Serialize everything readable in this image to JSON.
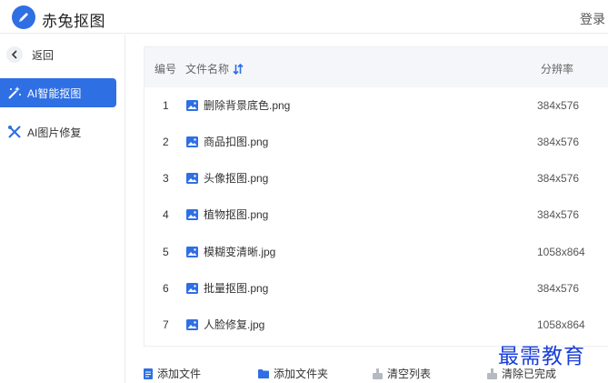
{
  "header": {
    "app_title": "赤兔抠图",
    "login_label": "登录",
    "logo_icon": "pen-logo-icon",
    "accent_color": "#2f6fe4"
  },
  "sidebar": {
    "back_label": "返回",
    "items": [
      {
        "label": "AI智能抠图",
        "icon": "magic-wand-icon",
        "active": true
      },
      {
        "label": "AI图片修复",
        "icon": "tools-icon",
        "active": false
      }
    ]
  },
  "table": {
    "columns": {
      "number": "编号",
      "filename": "文件名称",
      "resolution": "分辨率"
    },
    "rows": [
      {
        "number": "1",
        "filename": "删除背景底色.png",
        "resolution": "384x576"
      },
      {
        "number": "2",
        "filename": "商品扣图.png",
        "resolution": "384x576"
      },
      {
        "number": "3",
        "filename": "头像抠图.png",
        "resolution": "384x576"
      },
      {
        "number": "4",
        "filename": "植物抠图.png",
        "resolution": "384x576"
      },
      {
        "number": "5",
        "filename": "模糊变清晰.jpg",
        "resolution": "1058x864"
      },
      {
        "number": "6",
        "filename": "批量抠图.png",
        "resolution": "384x576"
      },
      {
        "number": "7",
        "filename": "人脸修复.jpg",
        "resolution": "1058x864"
      }
    ]
  },
  "footer": {
    "add_file": "添加文件",
    "add_folder": "添加文件夹",
    "clear_list": "清空列表",
    "clear_done": "清除已完成"
  },
  "watermark": "最需教育"
}
